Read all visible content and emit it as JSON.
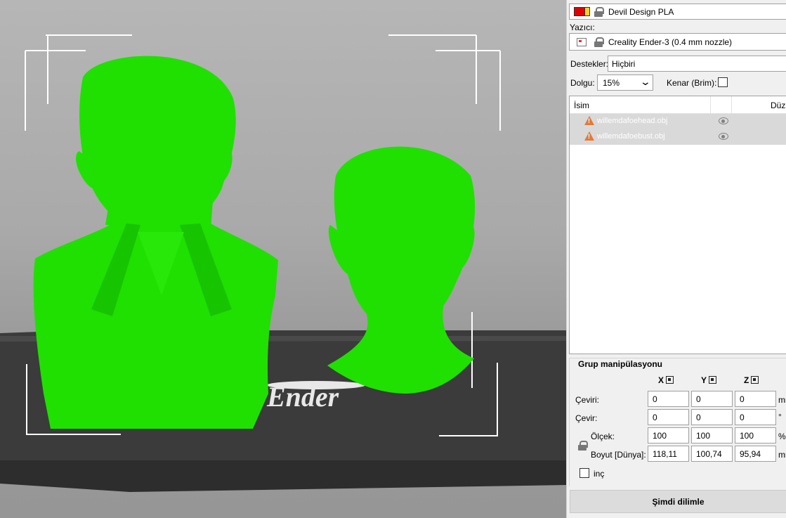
{
  "material": {
    "name": "Devil Design PLA",
    "swatch_colors": [
      "#e00000",
      "#f2d02a"
    ]
  },
  "printer": {
    "label": "Yazıcı:",
    "name": "Creality Ender-3 (0.4 mm nozzle)"
  },
  "supports": {
    "label": "Destekler:",
    "value": "Hiçbiri"
  },
  "infill": {
    "label": "Dolgu:",
    "value": "15%"
  },
  "brim": {
    "label": "Kenar (Brim):",
    "checked": false
  },
  "object_list": {
    "columns": [
      "İsim",
      "Düz"
    ],
    "items": [
      {
        "name": "willemdafoehead.obj",
        "status_icon": "warning-icon",
        "visible": true
      },
      {
        "name": "willemdafoebust.obj",
        "status_icon": "warning-icon",
        "visible": true
      }
    ]
  },
  "group_manipulation": {
    "title": "Grup manipülasyonu",
    "axes": [
      "X",
      "Y",
      "Z"
    ],
    "rows": [
      {
        "label": "Çeviri:",
        "values": [
          "0",
          "0",
          "0"
        ],
        "unit": "mm"
      },
      {
        "label": "Çevir:",
        "values": [
          "0",
          "0",
          "0"
        ],
        "unit": "°"
      },
      {
        "label": "Ölçek:",
        "values": [
          "100",
          "100",
          "100"
        ],
        "unit": "%"
      },
      {
        "label": "Boyut [Dünya]:",
        "values": [
          "118,11",
          "100,74",
          "95,94"
        ],
        "unit": "mm"
      }
    ],
    "inch_label": "inç",
    "inch_checked": false
  },
  "slice_button": "Şimdi dilimle",
  "bed": {
    "logo_text": "Ender"
  },
  "colors": {
    "model": "#1fe000",
    "bed": "#3a3a3a",
    "accent_warning": "#e07a3c"
  }
}
